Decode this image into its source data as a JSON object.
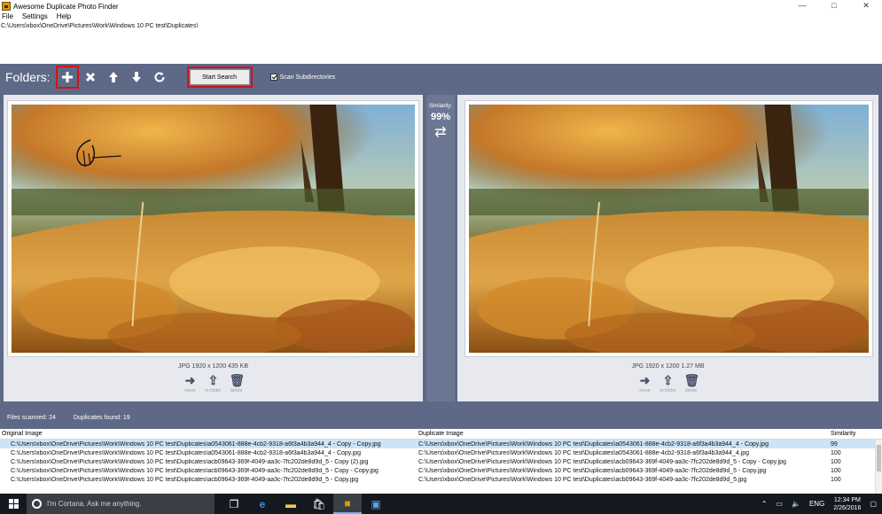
{
  "window": {
    "title": "Awesome Duplicate Photo Finder",
    "controls": [
      "—",
      "□",
      "✕"
    ]
  },
  "menu": [
    "File",
    "Settings",
    "Help"
  ],
  "path": "C:\\Users\\xbox\\OneDrive\\Pictures\\Work\\Windows 10 PC test\\Duplicates\\",
  "toolbar": {
    "folders_label": "Folders:",
    "start_search_label": "Start Search",
    "scan_subdirectories_label": "Scan Subdirectories",
    "scan_subdirectories_checked": true
  },
  "left_image": {
    "info": "JPG  1920 x 1200  435 KB",
    "actions": [
      "move",
      "to folder",
      "delete"
    ]
  },
  "right_image": {
    "info": "JPG  1920 x 1200  1.27 MB",
    "actions": [
      "move",
      "to folder",
      "delete"
    ]
  },
  "similarity": {
    "label": "Similarity:",
    "value": "99%"
  },
  "status": {
    "files_scanned": "Files scanned: 24",
    "duplicates_found": "Duplicates found: 19"
  },
  "results": {
    "headers": {
      "original": "Original Image",
      "duplicate": "Duplicate Image",
      "similarity": "Similarity"
    },
    "rows": [
      {
        "original": "C:\\Users\\xbox\\OneDrive\\Pictures\\Work\\Windows 10 PC test\\Duplicates\\a0543061-888e-4cb2-9318-a6f3a4b3a944_4 - Copy - Copy.jpg",
        "duplicate": "C:\\Users\\xbox\\OneDrive\\Pictures\\Work\\Windows 10 PC test\\Duplicates\\a0543061-888e-4cb2-9318-a6f3a4b3a944_4 - Copy.jpg",
        "similarity": "99",
        "selected": true
      },
      {
        "original": "C:\\Users\\xbox\\OneDrive\\Pictures\\Work\\Windows 10 PC test\\Duplicates\\a0543061-888e-4cb2-9318-a6f3a4b3a944_4 - Copy.jpg",
        "duplicate": "C:\\Users\\xbox\\OneDrive\\Pictures\\Work\\Windows 10 PC test\\Duplicates\\a0543061-888e-4cb2-9318-a6f3a4b3a944_4.jpg",
        "similarity": "100",
        "selected": false
      },
      {
        "original": "C:\\Users\\xbox\\OneDrive\\Pictures\\Work\\Windows 10 PC test\\Duplicates\\acb09643-369f-4049-aa3c-7fc202de8d9d_5 - Copy (2).jpg",
        "duplicate": "C:\\Users\\xbox\\OneDrive\\Pictures\\Work\\Windows 10 PC test\\Duplicates\\acb09643-369f-4049-aa3c-7fc202de8d9d_5 - Copy - Copy.jpg",
        "similarity": "100",
        "selected": false
      },
      {
        "original": "C:\\Users\\xbox\\OneDrive\\Pictures\\Work\\Windows 10 PC test\\Duplicates\\acb09643-369f-4049-aa3c-7fc202de8d9d_5 - Copy - Copy.jpg",
        "duplicate": "C:\\Users\\xbox\\OneDrive\\Pictures\\Work\\Windows 10 PC test\\Duplicates\\acb09643-369f-4049-aa3c-7fc202de8d9d_5 - Copy.jpg",
        "similarity": "100",
        "selected": false
      },
      {
        "original": "C:\\Users\\xbox\\OneDrive\\Pictures\\Work\\Windows 10 PC test\\Duplicates\\acb09643-369f-4049-aa3c-7fc202de8d9d_5 - Copy.jpg",
        "duplicate": "C:\\Users\\xbox\\OneDrive\\Pictures\\Work\\Windows 10 PC test\\Duplicates\\acb09643-369f-4049-aa3c-7fc202de8d9d_5.jpg",
        "similarity": "100",
        "selected": false
      }
    ]
  },
  "taskbar": {
    "cortana_placeholder": "I'm Cortana. Ask me anything.",
    "language": "ENG",
    "time": "12:34 PM",
    "date": "2/26/2016"
  },
  "colors": {
    "toolbar_bg": "#5d6986",
    "highlight_red": "#d0141c",
    "selected_row": "#cce4f7"
  },
  "icons": {
    "toolbar": [
      "plus-icon",
      "close-icon",
      "arrow-up-icon",
      "arrow-down-icon",
      "refresh-icon"
    ],
    "actions": [
      "arrow-right-icon",
      "upload-icon",
      "trash-icon"
    ],
    "similarity": "swap-icon"
  }
}
